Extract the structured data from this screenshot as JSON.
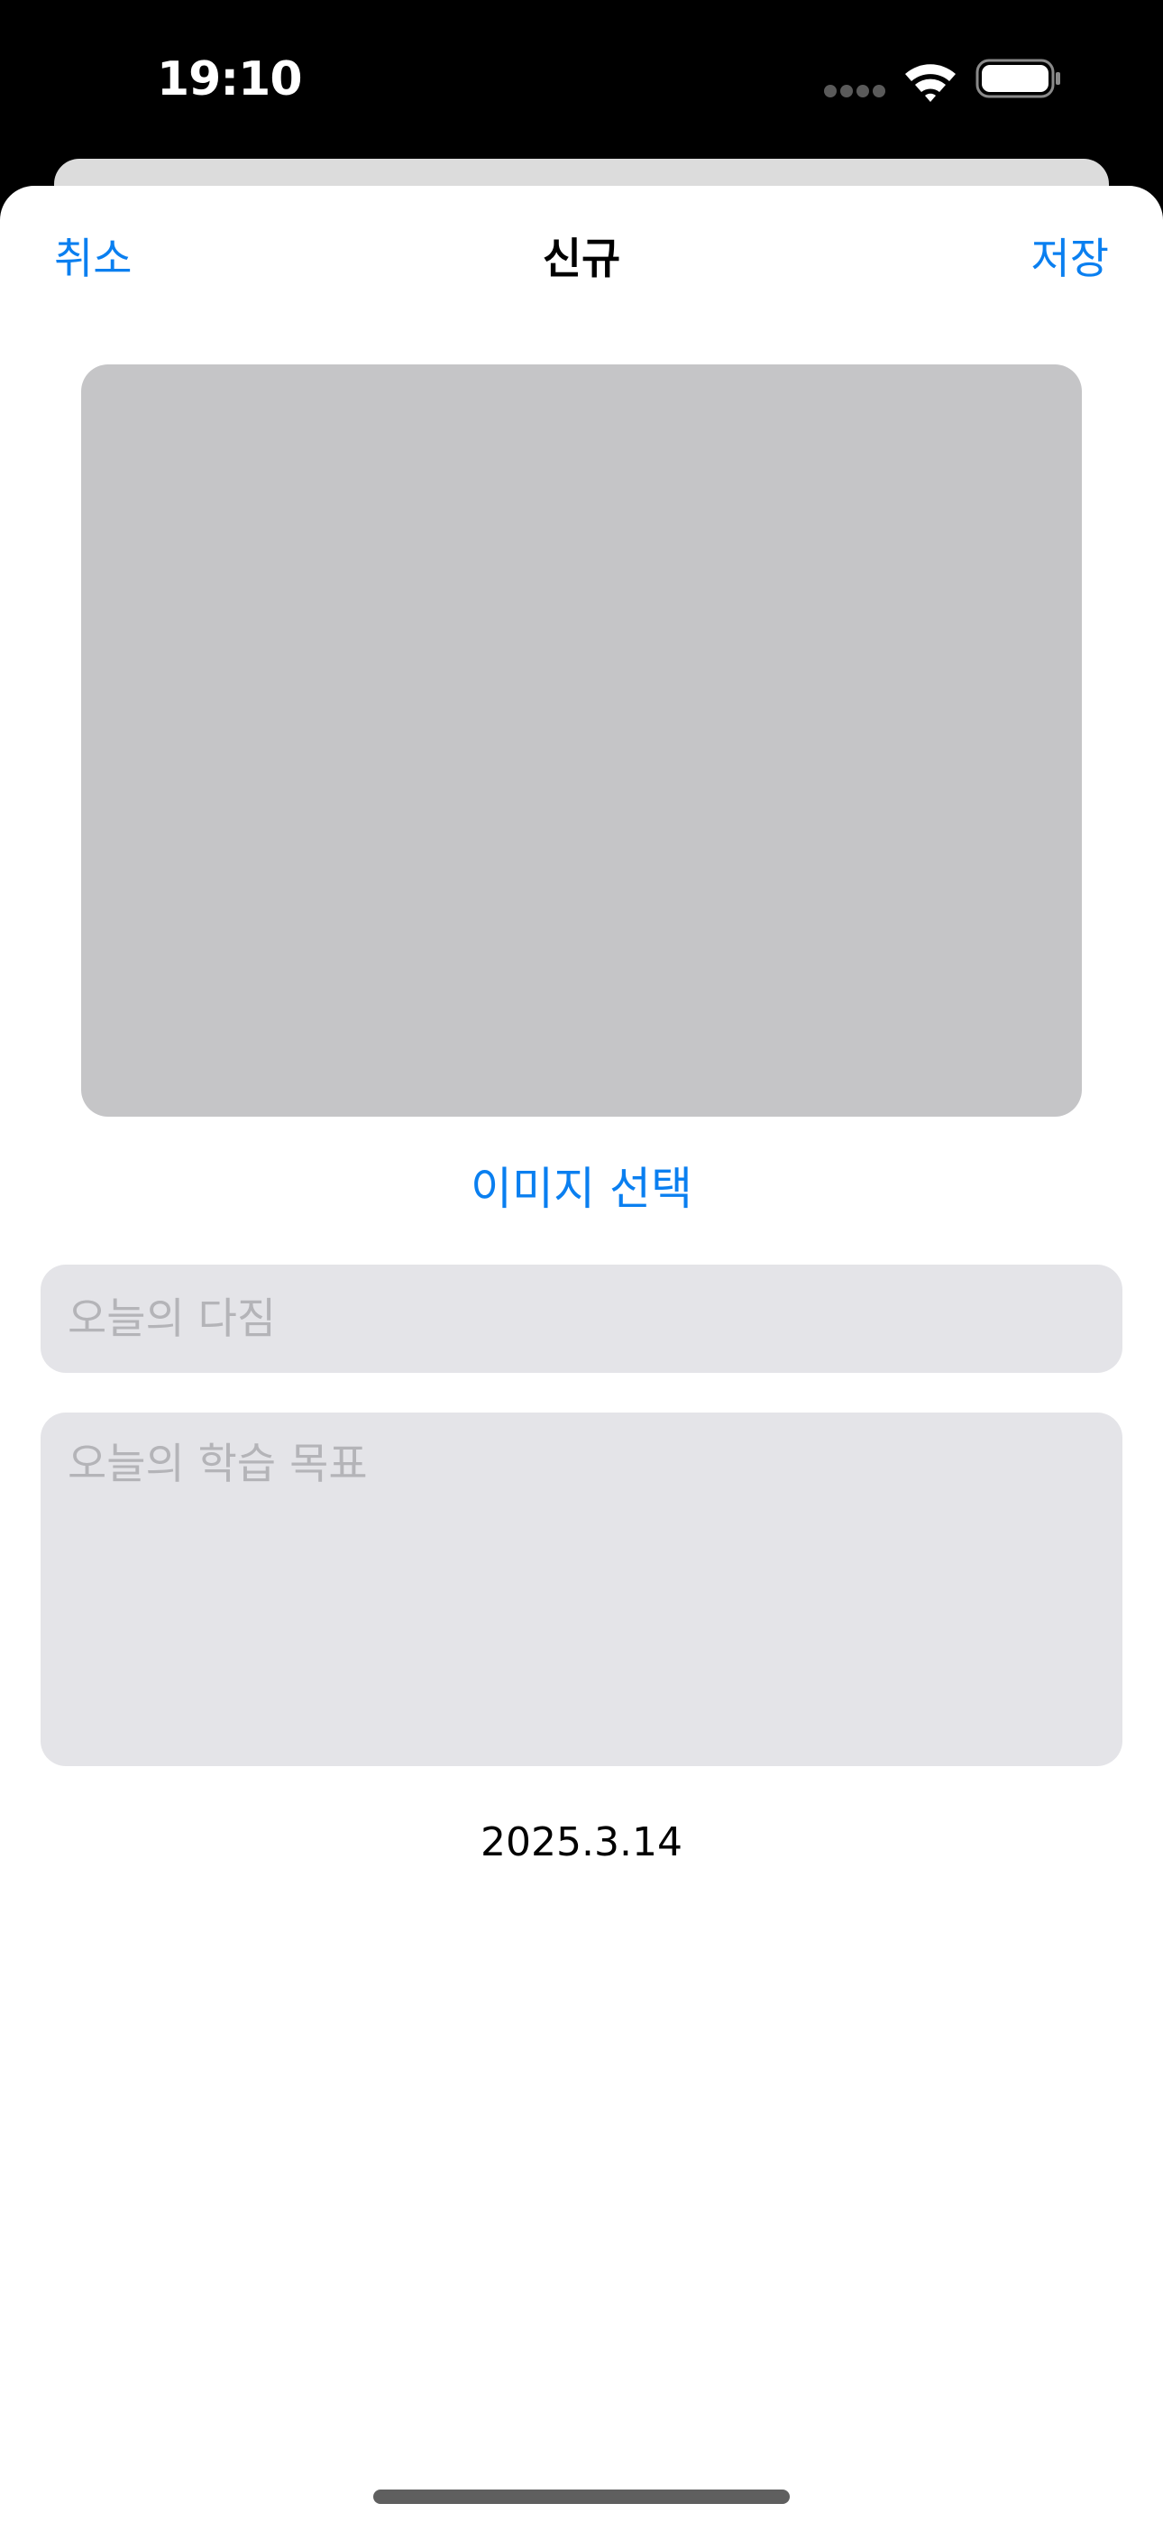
{
  "status_bar": {
    "time": "19:10",
    "icons": [
      "cellular-dots-icon",
      "wifi-icon",
      "battery-icon"
    ]
  },
  "nav": {
    "cancel_label": "취소",
    "title": "신규",
    "save_label": "저장"
  },
  "image_section": {
    "select_label": "이미지 선택"
  },
  "form": {
    "resolution_placeholder": "오늘의 다짐",
    "resolution_value": "",
    "goal_placeholder": "오늘의 학습 목표",
    "goal_value": ""
  },
  "date": "2025.3.14",
  "colors": {
    "accent": "#0a7ff0",
    "field_background": "#e4e4e8",
    "placeholder_text": "#b4b4b8",
    "image_placeholder": "#c5c5c7"
  }
}
